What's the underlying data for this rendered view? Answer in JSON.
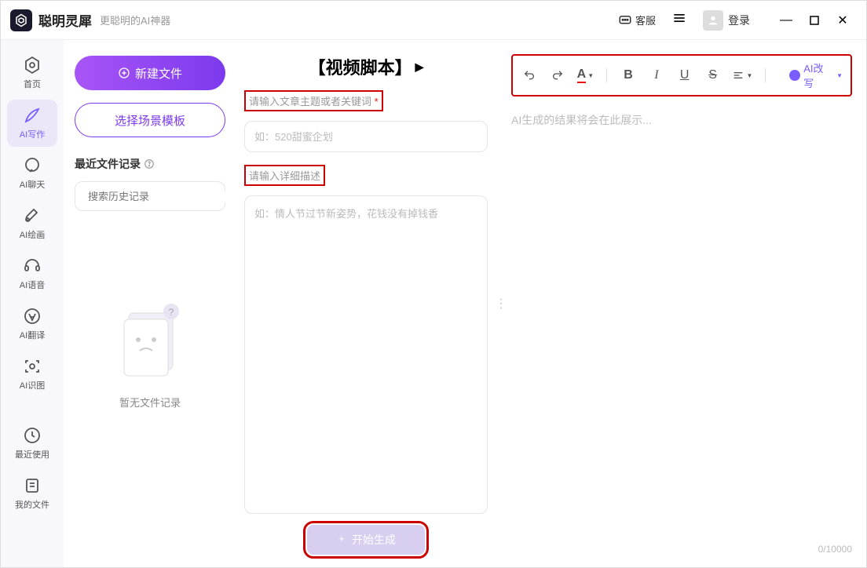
{
  "titlebar": {
    "app_name": "聪明灵犀",
    "subtitle": "更聪明的AI神器",
    "customer_service": "客服",
    "login": "登录"
  },
  "sidebar": {
    "items": [
      {
        "label": "首页"
      },
      {
        "label": "AI写作"
      },
      {
        "label": "AI聊天"
      },
      {
        "label": "AI绘画"
      },
      {
        "label": "AI语音"
      },
      {
        "label": "AI翻译"
      },
      {
        "label": "AI识图"
      },
      {
        "label": "最近使用"
      },
      {
        "label": "我的文件"
      }
    ]
  },
  "leftpanel": {
    "new_file": "新建文件",
    "choose_template": "选择场景模板",
    "recent_title": "最近文件记录",
    "search_placeholder": "搜索历史记录",
    "empty_text": "暂无文件记录"
  },
  "center": {
    "title": "【视频脚本】",
    "topic_label": "请输入文章主题或者关键词",
    "topic_placeholder": "如：520甜蜜企划",
    "desc_label": "请输入详细描述",
    "desc_placeholder": "如：情人节过节新姿势，花钱没有掉钱香",
    "generate": "开始生成"
  },
  "right": {
    "placeholder": "AI生成的结果将会在此展示...",
    "ai_rewrite": "AI改写",
    "counter": "0/10000"
  }
}
